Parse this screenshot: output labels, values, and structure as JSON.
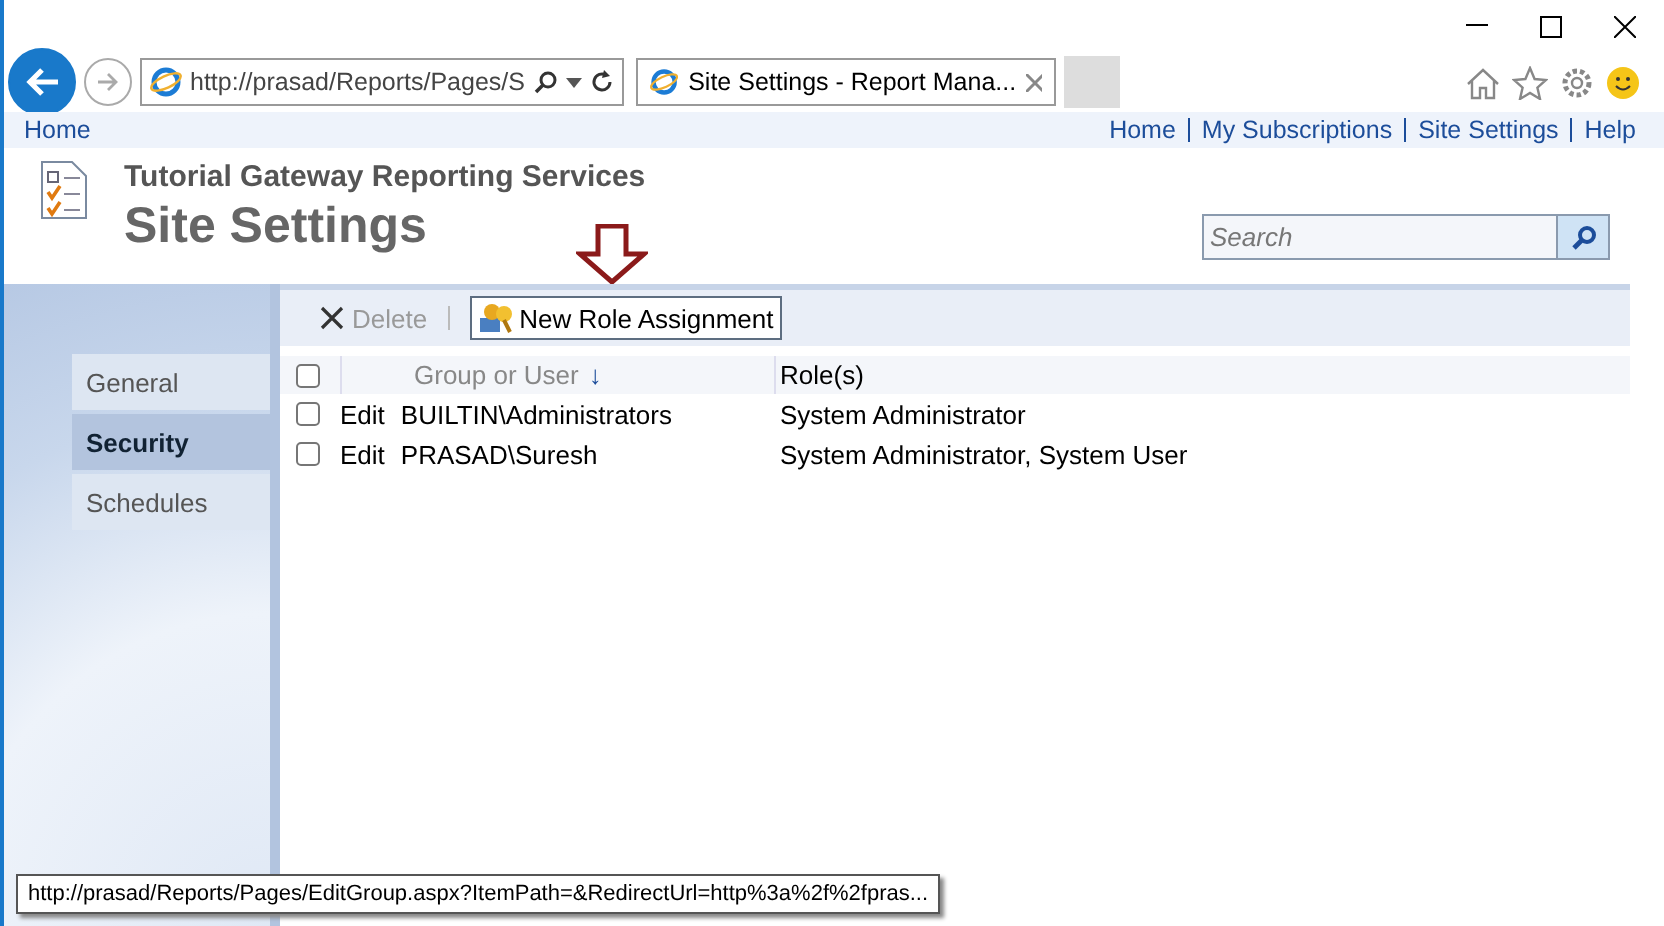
{
  "browser": {
    "address": "http://prasad/Reports/Pages/S",
    "tab_title": "Site Settings - Report Mana..."
  },
  "top_links": {
    "left": "Home",
    "right": [
      "Home",
      "My Subscriptions",
      "Site Settings",
      "Help"
    ]
  },
  "header": {
    "subtitle": "Tutorial Gateway Reporting Services",
    "title": "Site Settings",
    "search": {
      "placeholder": "Search"
    }
  },
  "sidebar": {
    "items": [
      {
        "label": "General",
        "selected": false
      },
      {
        "label": "Security",
        "selected": true
      },
      {
        "label": "Schedules",
        "selected": false
      }
    ]
  },
  "toolbar": [
    {
      "kind": "delete",
      "label": "Delete",
      "disabled": true
    },
    {
      "kind": "new",
      "label": "New Role Assignment",
      "disabled": false
    }
  ],
  "table": {
    "select_all": {
      "checked": false
    },
    "columns": [
      "Group or User",
      "Role(s)"
    ],
    "sort_mark": "↓",
    "rows": [
      {
        "action": "Edit",
        "group": "BUILTIN\\Administrators",
        "roles": "System Administrator",
        "checked": false
      },
      {
        "action": "Edit",
        "group": "PRASAD\\Suresh",
        "roles": "System Administrator, System User",
        "checked": false
      }
    ]
  },
  "status_url": "http://prasad/Reports/Pages/EditGroup.aspx?ItemPath=&RedirectUrl=http%3a%2f%2fpras..."
}
